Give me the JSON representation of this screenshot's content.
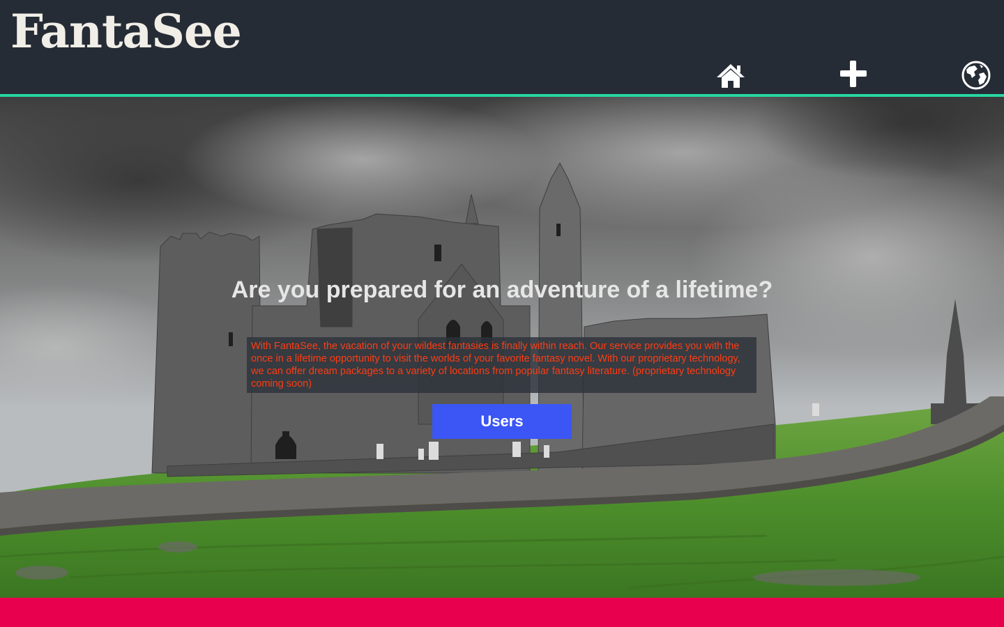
{
  "brand": {
    "logo_text": "FantaSee"
  },
  "nav": {
    "items": [
      {
        "icon": "home-icon"
      },
      {
        "icon": "plus-icon"
      },
      {
        "icon": "globe-icon"
      }
    ]
  },
  "hero": {
    "headline": "Are you prepared for an adventure of a lifetime?",
    "intro": "With FantaSee, the vacation of your wildest fantasies is finally within reach. Our service provides you with the once in a lifetime opportunity to visit the worlds of your favorite fantasy novel. With our proprietary technology, we can offer dream packages to a variety of locations from popular fantasy literature. (proprietary technology coming soon)",
    "cta_label": "Users",
    "background_image": "castle-ruins-on-green-hill-under-stormy-sky"
  },
  "colors": {
    "header_bg": "#262c35",
    "header_rule": "#27d6a1",
    "logo_text": "#f1eee8",
    "headline_text": "#e6e6e6",
    "intro_text": "#ff3d12",
    "cta_bg": "#3b56f5",
    "footer_bg": "#e8004f"
  }
}
